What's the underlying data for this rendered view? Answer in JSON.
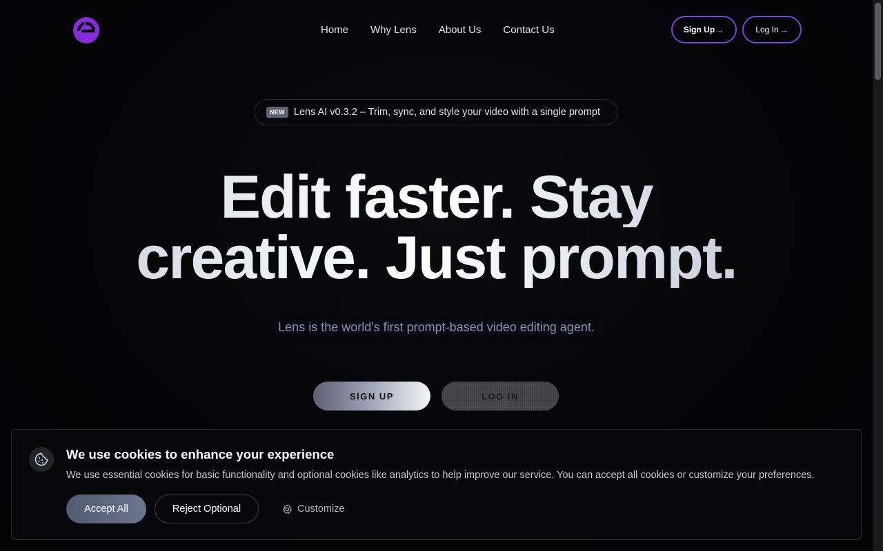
{
  "header": {
    "nav": [
      {
        "label": "Home"
      },
      {
        "label": "Why Lens"
      },
      {
        "label": "About Us"
      },
      {
        "label": "Contact Us"
      }
    ],
    "signup_label": "Sign Up",
    "login_label": "Log In",
    "arrow_glyph": "→",
    "accent_color": "#7b3fe4"
  },
  "announcement": {
    "badge": "NEW",
    "text": "Lens AI v0.3.2 – Trim, sync, and style your video with a single prompt"
  },
  "hero": {
    "headline_line1": "Edit faster. Stay",
    "headline_line2": "creative. Just prompt.",
    "subtitle": "Lens is the world's first prompt-based video editing agent.",
    "cta_signup": "SIGN UP",
    "cta_login": "LOG IN"
  },
  "cookie_banner": {
    "icon": "cookie-icon",
    "title": "We use cookies to enhance your experience",
    "description": "We use essential cookies for basic functionality and optional cookies like analytics to help improve our service. You can accept all cookies or customize your preferences.",
    "accept_label": "Accept All",
    "reject_label": "Reject Optional",
    "customize_label": "Customize",
    "customize_icon": "gear-icon"
  }
}
